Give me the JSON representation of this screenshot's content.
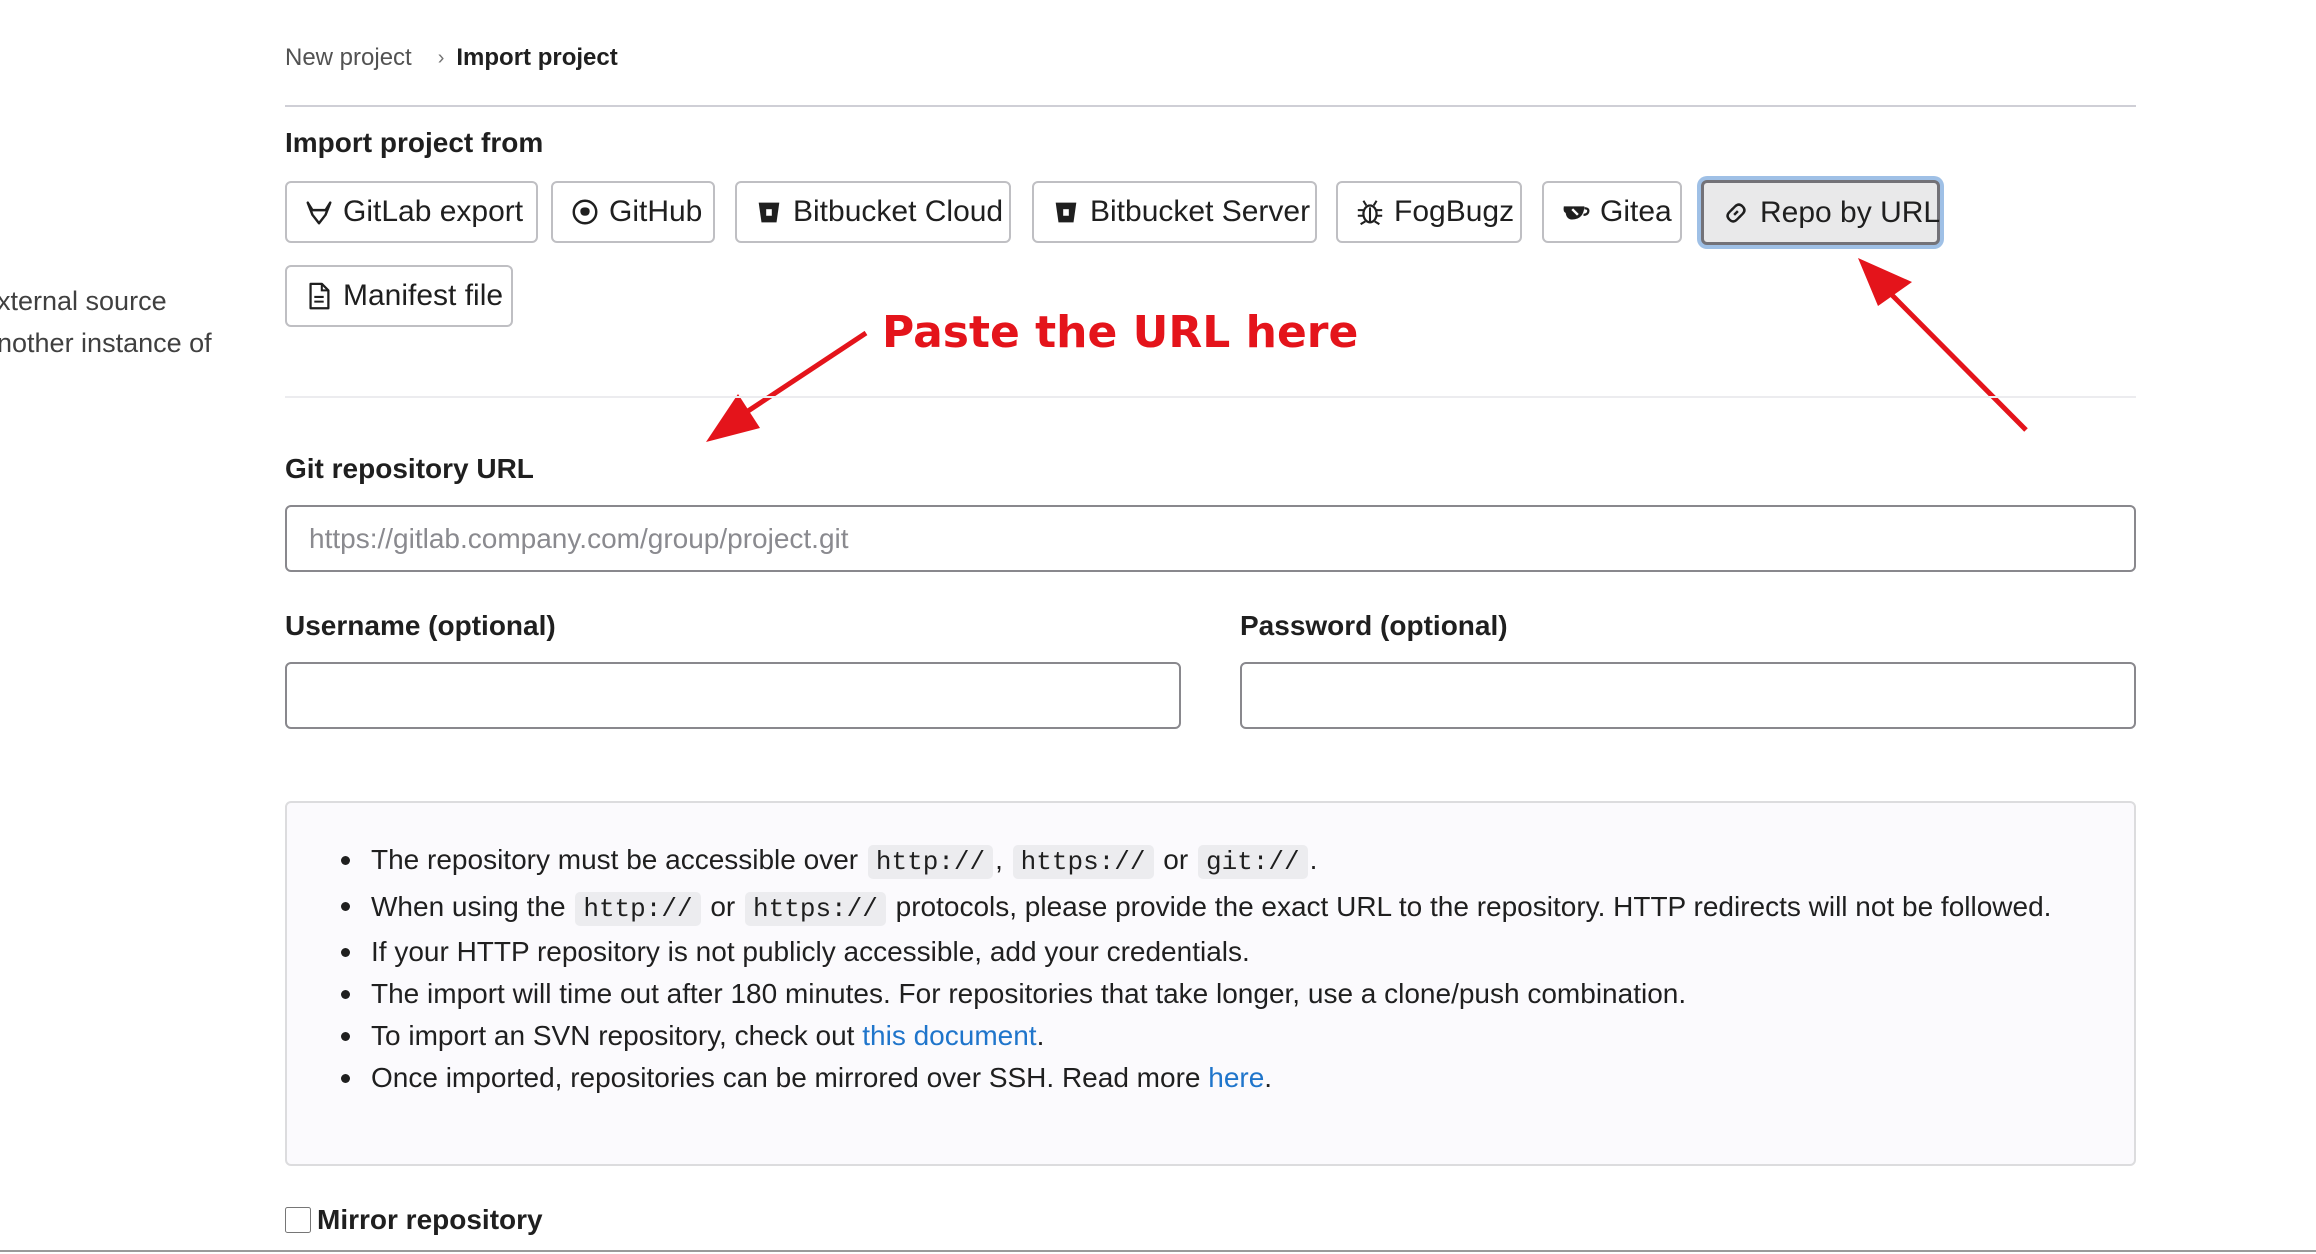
{
  "breadcrumb": {
    "parent": "New project",
    "separator": "›",
    "current": "Import project"
  },
  "left_fragment": {
    "line1": "xternal source",
    "line2": "nother instance of"
  },
  "import_from": {
    "title": "Import project from",
    "buttons": [
      {
        "label": "GitLab export",
        "icon": "gitlab-icon"
      },
      {
        "label": "GitHub",
        "icon": "github-icon"
      },
      {
        "label": "Bitbucket Cloud",
        "icon": "bitbucket-icon"
      },
      {
        "label": "Bitbucket Server",
        "icon": "bitbucket-icon"
      },
      {
        "label": "FogBugz",
        "icon": "bug-icon"
      },
      {
        "label": "Gitea",
        "icon": "gitea-icon"
      },
      {
        "label": "Repo by URL",
        "icon": "link-icon",
        "active": true
      },
      {
        "label": "Manifest file",
        "icon": "document-icon"
      }
    ]
  },
  "annotation": {
    "text": "Paste the URL here",
    "color": "#e4141b"
  },
  "form": {
    "repo_url_label": "Git repository URL",
    "repo_url_placeholder": "https://gitlab.company.com/group/project.git",
    "repo_url_value": "",
    "username_label": "Username (optional)",
    "username_value": "",
    "password_label": "Password (optional)",
    "password_value": ""
  },
  "info": {
    "item1": {
      "a": "The repository must be accessible over ",
      "c1": "http://",
      "b": ", ",
      "c2": "https://",
      "c": " or ",
      "c3": "git://",
      "d": "."
    },
    "item2": {
      "a": "When using the ",
      "c1": "http://",
      "b": " or ",
      "c2": "https://",
      "c": " protocols, please provide the exact URL to the repository. HTTP redirects will not be followed."
    },
    "item3": "If your HTTP repository is not publicly accessible, add your credentials.",
    "item4": "The import will time out after 180 minutes. For repositories that take longer, use a clone/push combination.",
    "item5": {
      "a": "To import an SVN repository, check out ",
      "link": "this document",
      "b": "."
    },
    "item6": {
      "a": "Once imported, repositories can be mirrored over SSH. Read more ",
      "link": "here",
      "b": "."
    }
  },
  "mirror": {
    "label": "Mirror repository",
    "checked": false
  },
  "colors": {
    "link": "#1f75cb",
    "active_ring": "#9fc0e6",
    "annotation": "#e4141b"
  }
}
